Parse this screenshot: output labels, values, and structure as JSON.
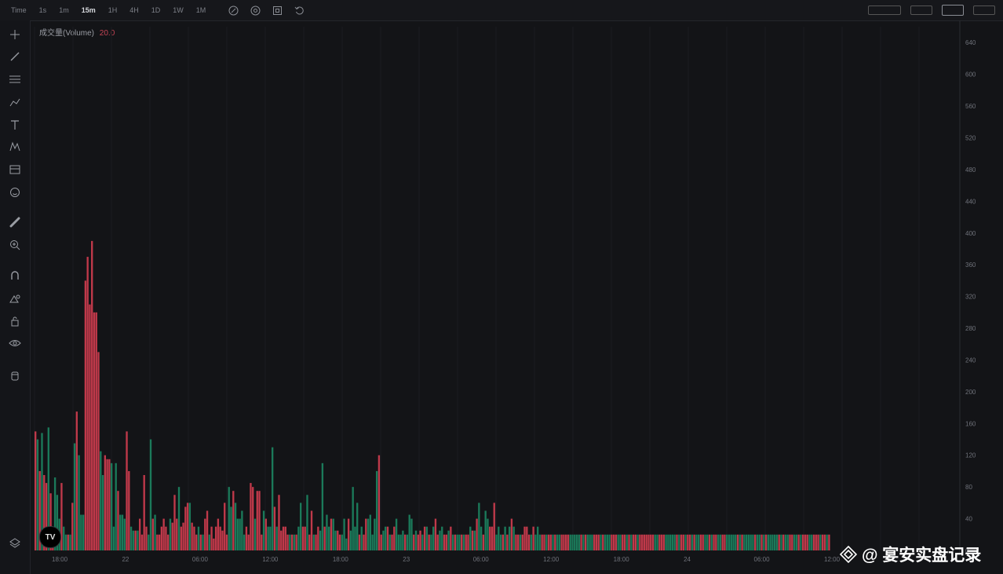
{
  "toolbar": {
    "timeframes": [
      "Time",
      "1s",
      "1m",
      "15m",
      "1H",
      "4H",
      "1D",
      "1W",
      "1M"
    ],
    "active_timeframe": "15m",
    "icons": [
      "indicator-icon",
      "settings-icon",
      "fullscreen-icon",
      "undo-icon"
    ]
  },
  "legend": {
    "name": "成交量(Volume)",
    "value": "20.0"
  },
  "sidebar": {
    "tools": [
      "crosshair-icon",
      "trend-line-icon",
      "horizontal-lines-icon",
      "brush-icon",
      "text-icon",
      "pattern-icon",
      "measure-icon",
      "emoji-icon",
      "ruler-icon",
      "zoom-icon",
      "magnet-icon",
      "lock-drawing-icon",
      "unlock-icon",
      "eye-icon",
      "trash-icon"
    ]
  },
  "colors": {
    "up": "#1b7a5a",
    "down": "#c0394a",
    "background": "#131417",
    "grid": "#1b1c20",
    "axis_text": "#6f727a"
  },
  "watermark": "@ 宴安实盘记录",
  "chart_data": {
    "type": "bar",
    "title": "",
    "xlabel": "",
    "ylabel": "",
    "x_ticks": [
      "18:00",
      "22",
      "06:00",
      "12:00",
      "18:00",
      "23",
      "06:00",
      "12:00",
      "18:00",
      "24",
      "06:00",
      "12:00"
    ],
    "y_ticks": [
      0,
      40,
      80,
      120,
      160,
      200,
      240,
      280,
      320,
      360,
      400,
      440,
      480,
      520,
      560,
      600,
      640
    ],
    "ylim": [
      0,
      660
    ],
    "series": [
      {
        "values": [
          150,
          140,
          100,
          148,
          95,
          85,
          155,
          72,
          30,
          92,
          70,
          40,
          85,
          30,
          20,
          20,
          20,
          60,
          135,
          175,
          120,
          45,
          45,
          340,
          370,
          310,
          390,
          300,
          300,
          250,
          125,
          95,
          120,
          115,
          115,
          110,
          30,
          110,
          75,
          45,
          45,
          40,
          150,
          100,
          30,
          25,
          25,
          25,
          40,
          20,
          95,
          30,
          20,
          140,
          40,
          45,
          20,
          20,
          30,
          40,
          30,
          20,
          40,
          35,
          70,
          40,
          80,
          30,
          35,
          55,
          60,
          60,
          35,
          30,
          20,
          30,
          20,
          20,
          40,
          50,
          20,
          30,
          15,
          30,
          40,
          30,
          25,
          60,
          20,
          80,
          55,
          75,
          60,
          40,
          40,
          50,
          20,
          30,
          20,
          85,
          80,
          40,
          75,
          75,
          20,
          50,
          40,
          30,
          30,
          130,
          55,
          30,
          70,
          25,
          30,
          30,
          20,
          20,
          20,
          20,
          20,
          30,
          60,
          30,
          30,
          70,
          20,
          50,
          20,
          20,
          30,
          25,
          110,
          30,
          45,
          30,
          40,
          40,
          25,
          25,
          20,
          20,
          40,
          15,
          40,
          25,
          80,
          30,
          60,
          20,
          30,
          20,
          40,
          40,
          45,
          20,
          40,
          100,
          120,
          20,
          25,
          30,
          30,
          20,
          20,
          30,
          40,
          20,
          20,
          25,
          20,
          20,
          45,
          40,
          20,
          25,
          20,
          25,
          20,
          30,
          30,
          20,
          20,
          30,
          40,
          20,
          25,
          30,
          20,
          20,
          25,
          30,
          20,
          20,
          20,
          20,
          20,
          20,
          20,
          20,
          30,
          25,
          25,
          40,
          60,
          30,
          20,
          50,
          40,
          30,
          30,
          60,
          20,
          30,
          20,
          20,
          30,
          20,
          30,
          40,
          30,
          20,
          20,
          20,
          20,
          30,
          30,
          20,
          20,
          30,
          20,
          30,
          20,
          20,
          20,
          20,
          20,
          20,
          20,
          20,
          20,
          20,
          20,
          20,
          20,
          20,
          20,
          20,
          20,
          20,
          20,
          20,
          20,
          20,
          20,
          20,
          20,
          20,
          20,
          20,
          20,
          20,
          20,
          20,
          20,
          20,
          20,
          20,
          20,
          20,
          20,
          20,
          20,
          20,
          20,
          20,
          20,
          20,
          20,
          20,
          20,
          20,
          20,
          20,
          20,
          20,
          20,
          20,
          20,
          20,
          20,
          20,
          20,
          20,
          20,
          20,
          20,
          20,
          20,
          20,
          20,
          20,
          20,
          20,
          20,
          20,
          20,
          20,
          20,
          20,
          20,
          20,
          20,
          20,
          20,
          20,
          20,
          20,
          20,
          20,
          20,
          20,
          20,
          20,
          20,
          20,
          20,
          20,
          20,
          20,
          20,
          20,
          20,
          20,
          20,
          20,
          20,
          20,
          20,
          20,
          20,
          20,
          20,
          20,
          20,
          20,
          20,
          20,
          20,
          20,
          20,
          20,
          20,
          20,
          20,
          20,
          20,
          20,
          20,
          20,
          20,
          20,
          20,
          20,
          20,
          20
        ],
        "directions": []
      }
    ]
  }
}
